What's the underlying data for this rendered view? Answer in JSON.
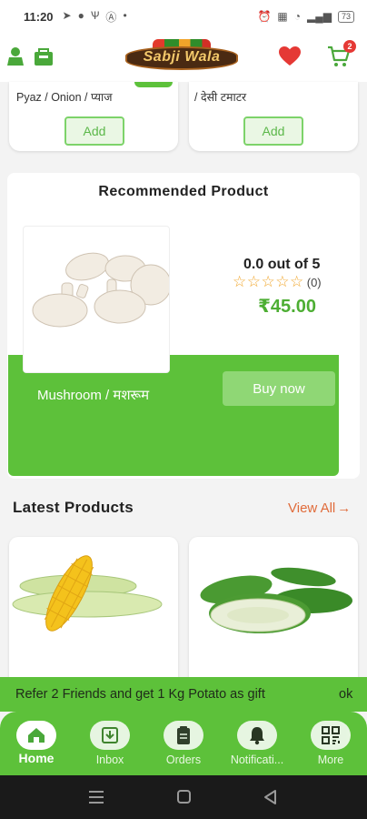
{
  "status_bar": {
    "time": "11:20",
    "battery": "73"
  },
  "header": {
    "logo_text": "Sabji Wala",
    "cart_count": "2"
  },
  "top_products": [
    {
      "name": "Pyaz / Onion / प्याज",
      "add_label": "Add"
    },
    {
      "name": "/ देसी टमाटर",
      "add_label": "Add"
    }
  ],
  "recommended": {
    "title": "Recommended Product",
    "product_name": "Mushroom / मशरूम",
    "rating_text": "0.0 out of 5",
    "rating_value": 0,
    "review_count": "(0)",
    "price": "₹45.00",
    "buy_label": "Buy now"
  },
  "latest": {
    "title": "Latest Products",
    "view_all": "View All",
    "products": [
      {
        "icon": "corn-image"
      },
      {
        "icon": "cucumber-image"
      }
    ]
  },
  "referral": {
    "message": "Refer 2 Friends and get 1 Kg Potato as gift",
    "ok": "ok"
  },
  "bottom_nav": [
    {
      "label": "Home",
      "icon": "home-icon",
      "active": true
    },
    {
      "label": "Inbox",
      "icon": "inbox-icon"
    },
    {
      "label": "Orders",
      "icon": "orders-icon"
    },
    {
      "label": "Notificati...",
      "icon": "bell-icon"
    },
    {
      "label": "More",
      "icon": "grid-icon"
    }
  ],
  "colors": {
    "brand_green": "#5dc13a",
    "price_green": "#4dae33",
    "accent_orange": "#e06b3a",
    "heart_red": "#e53935",
    "star": "#f0a52a"
  }
}
